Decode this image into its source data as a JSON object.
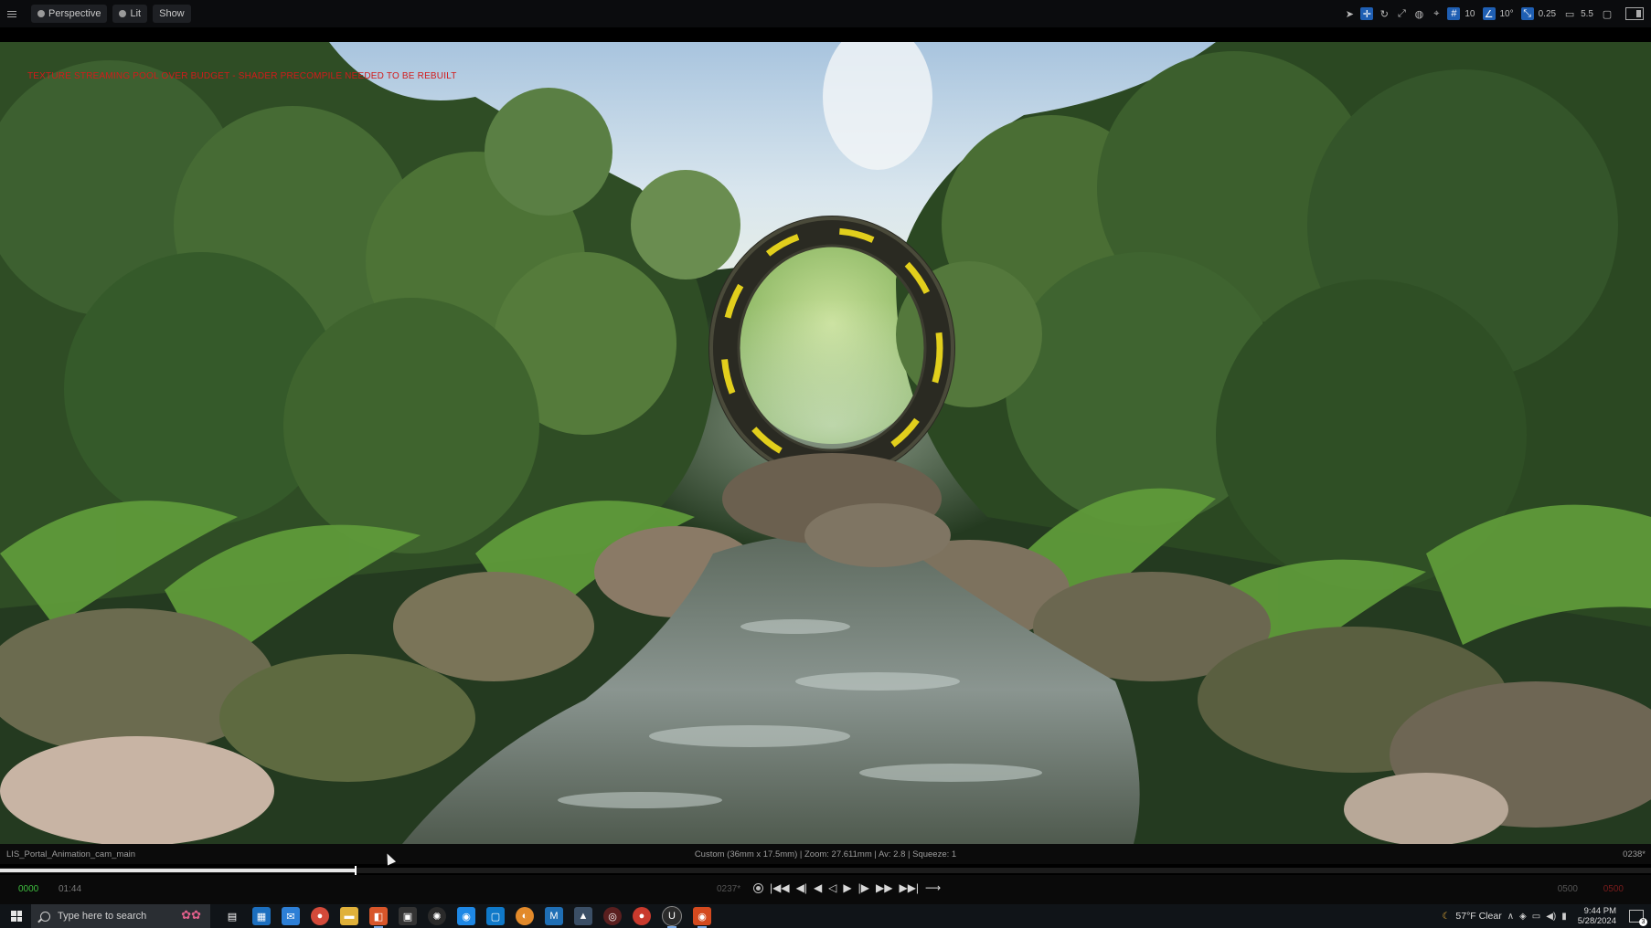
{
  "toolbar": {
    "perspective_label": "Perspective",
    "lit_label": "Lit",
    "show_label": "Show",
    "grid_snap_value": "10",
    "rotation_snap_value": "10°",
    "scale_snap_value": "0.25",
    "camera_speed_value": "5.5"
  },
  "viewport": {
    "warning_text": "TEXTURE STREAMING POOL OVER BUDGET - SHADER PRECOMPILE NEEDED TO BE REBUILT"
  },
  "infobar": {
    "shot_name": "LIS_Portal_Animation_cam_main",
    "lens_info": "Custom (36mm x 17.5mm) | Zoom: 27.611mm | Av: 2.8 | Squeeze: 1",
    "end_frame": "0238*"
  },
  "timeline": {
    "progress": 0.215
  },
  "transport": {
    "start_frame": "0000",
    "start_time": "01:44",
    "current_frame": "0237*",
    "end_frame": "0500",
    "end_marker": "0500"
  },
  "taskbar": {
    "search_placeholder": "Type here to search",
    "weather": "57°F  Clear",
    "time": "9:44 PM",
    "date": "5/28/2024"
  }
}
